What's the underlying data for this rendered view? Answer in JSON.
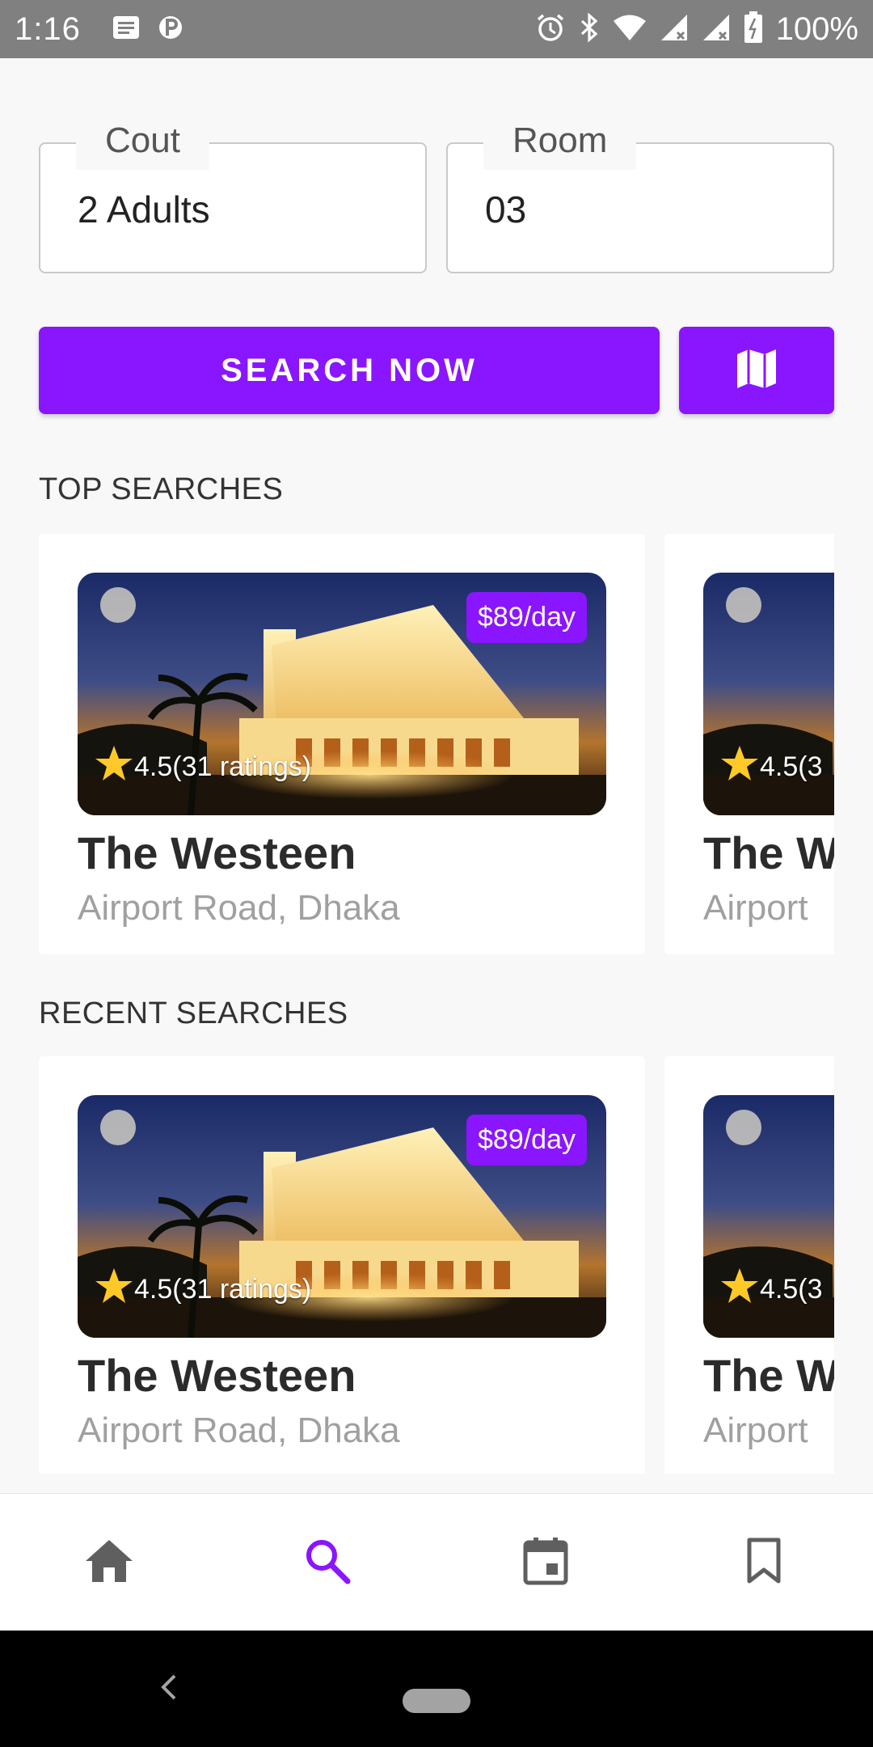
{
  "status_bar": {
    "time": "1:16",
    "battery_text": "100%",
    "icons": [
      "notification-icon",
      "p-icon",
      "alarm-icon",
      "bluetooth-icon",
      "wifi-icon",
      "signal-icon",
      "signal-icon",
      "battery-icon"
    ]
  },
  "form": {
    "count_label": "Cout",
    "count_value": "2 Adults",
    "room_label": "Room",
    "room_value": "03"
  },
  "search_button": "SEARCH NOW",
  "map_button_icon": "map-icon",
  "top_searches": {
    "title": "TOP SEARCHES",
    "cards": [
      {
        "name": "The Westeen",
        "location": "Airport Road, Dhaka",
        "price": "$89/day",
        "rating": "4.5(31 ratings)"
      },
      {
        "name": "The W",
        "location": "Airport",
        "price": "",
        "rating": "4.5(3"
      }
    ]
  },
  "recent_searches": {
    "title": "RECENT SEARCHES",
    "cards": [
      {
        "name": "The Westeen",
        "location": "Airport Road, Dhaka",
        "price": "$89/day",
        "rating": "4.5(31 ratings)"
      },
      {
        "name": "The W",
        "location": "Airport",
        "price": "",
        "rating": "4.5(3"
      }
    ]
  },
  "bottom_nav": {
    "items": [
      "home-icon",
      "search-icon",
      "calendar-icon",
      "bookmark-icon"
    ],
    "active": "search-icon"
  },
  "colors": {
    "accent": "#8a15ff",
    "status_bar": "#808080",
    "background": "#f8f8f8"
  }
}
